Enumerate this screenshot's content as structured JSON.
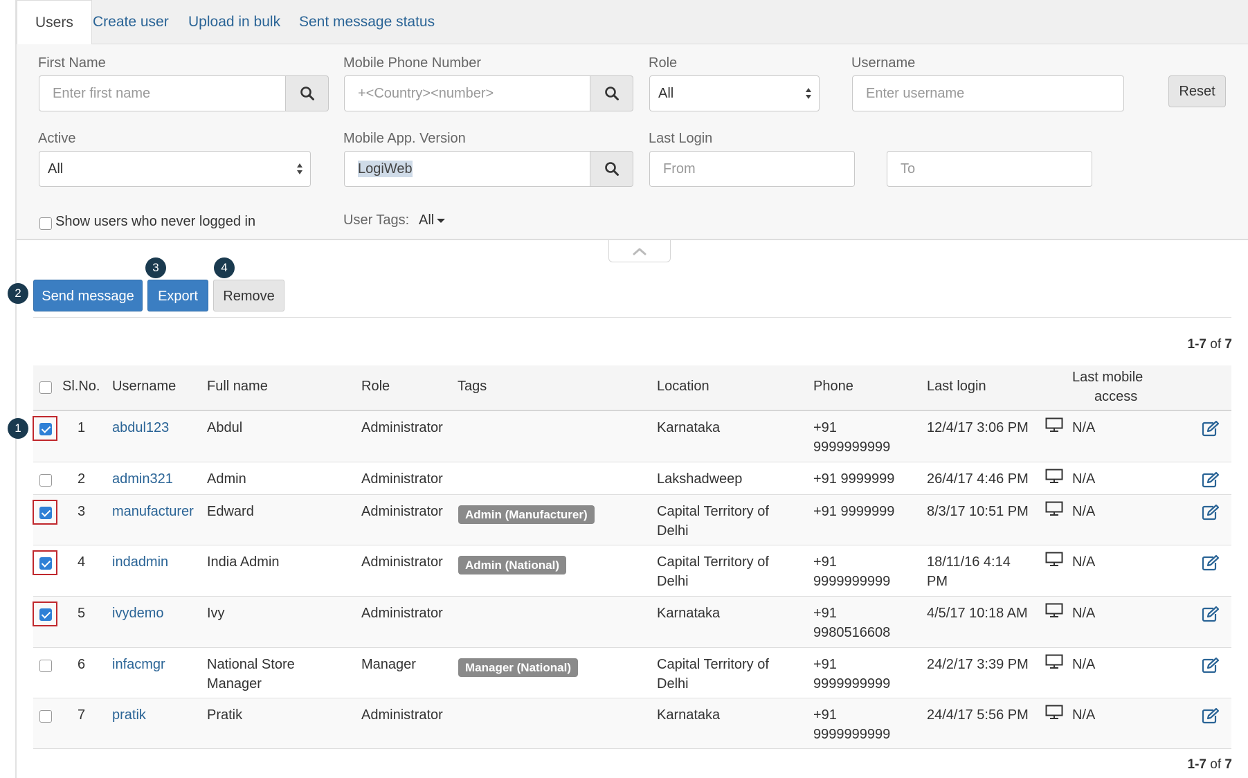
{
  "tabs": [
    {
      "label": "Users",
      "active": true
    },
    {
      "label": "Create user",
      "active": false
    },
    {
      "label": "Upload in bulk",
      "active": false
    },
    {
      "label": "Sent message status",
      "active": false
    }
  ],
  "filters": {
    "first_name": {
      "label": "First Name",
      "placeholder": "Enter first name"
    },
    "mobile_phone": {
      "label": "Mobile Phone Number",
      "placeholder": "+<Country><number>"
    },
    "role": {
      "label": "Role",
      "value": "All"
    },
    "username": {
      "label": "Username",
      "placeholder": "Enter username"
    },
    "reset_label": "Reset",
    "active": {
      "label": "Active",
      "value": "All"
    },
    "app_version": {
      "label": "Mobile App. Version",
      "value": "LogiWeb"
    },
    "last_login": {
      "label": "Last Login",
      "from_placeholder": "From",
      "to_placeholder": "To"
    },
    "never_logged_in": {
      "label": "Show users who never logged in",
      "checked": false
    },
    "user_tags": {
      "label": "User Tags:",
      "value": "All"
    }
  },
  "actions": {
    "send_message": "Send message",
    "export": "Export",
    "remove": "Remove"
  },
  "markers": [
    "1",
    "2",
    "3",
    "4"
  ],
  "pagination": {
    "range": "1-7",
    "of": "of",
    "total": "7"
  },
  "table": {
    "columns": {
      "slno": "Sl.No.",
      "username": "Username",
      "fullname": "Full name",
      "role": "Role",
      "tags": "Tags",
      "location": "Location",
      "phone": "Phone",
      "last_login": "Last login",
      "last_mobile_line1": "Last mobile",
      "last_mobile_line2": "access"
    },
    "rows": [
      {
        "selected": true,
        "no": "1",
        "username": "abdul123",
        "fullname": [
          "Abdul"
        ],
        "role": "Administrator",
        "tag": "",
        "location": [
          "Karnataka"
        ],
        "phone": [
          "+91",
          "9999999999"
        ],
        "last_login": [
          "12/4/17 3:06 PM"
        ],
        "last_mobile": "N/A"
      },
      {
        "selected": false,
        "no": "2",
        "username": "admin321",
        "fullname": [
          "Admin"
        ],
        "role": "Administrator",
        "tag": "",
        "location": [
          "Lakshadweep"
        ],
        "phone": [
          "+91 9999999"
        ],
        "last_login": [
          "26/4/17 4:46 PM"
        ],
        "last_mobile": "N/A"
      },
      {
        "selected": true,
        "no": "3",
        "username": "manufacturer",
        "fullname": [
          "Edward"
        ],
        "role": "Administrator",
        "tag": "Admin (Manufacturer)",
        "location": [
          "Capital Territory of",
          "Delhi"
        ],
        "phone": [
          "+91 9999999"
        ],
        "last_login": [
          "8/3/17 10:51 PM"
        ],
        "last_mobile": "N/A"
      },
      {
        "selected": true,
        "no": "4",
        "username": "indadmin",
        "fullname": [
          "India Admin"
        ],
        "role": "Administrator",
        "tag": "Admin (National)",
        "location": [
          "Capital Territory of",
          "Delhi"
        ],
        "phone": [
          "+91",
          "9999999999"
        ],
        "last_login": [
          "18/11/16 4:14",
          "PM"
        ],
        "last_mobile": "N/A"
      },
      {
        "selected": true,
        "no": "5",
        "username": "ivydemo",
        "fullname": [
          "Ivy"
        ],
        "role": "Administrator",
        "tag": "",
        "location": [
          "Karnataka"
        ],
        "phone": [
          "+91",
          "9980516608"
        ],
        "last_login": [
          "4/5/17 10:18 AM"
        ],
        "last_mobile": "N/A"
      },
      {
        "selected": false,
        "no": "6",
        "username": "infacmgr",
        "fullname": [
          "National Store",
          "Manager"
        ],
        "role": "Manager",
        "tag": "Manager (National)",
        "location": [
          "Capital Territory of",
          "Delhi"
        ],
        "phone": [
          "+91",
          "9999999999"
        ],
        "last_login": [
          "24/2/17 3:39 PM"
        ],
        "last_mobile": "N/A"
      },
      {
        "selected": false,
        "no": "7",
        "username": "pratik",
        "fullname": [
          "Pratik"
        ],
        "role": "Administrator",
        "tag": "",
        "location": [
          "Karnataka"
        ],
        "phone": [
          "+91",
          "9999999999"
        ],
        "last_login": [
          "24/4/17 5:56 PM"
        ],
        "last_mobile": "N/A"
      }
    ]
  }
}
